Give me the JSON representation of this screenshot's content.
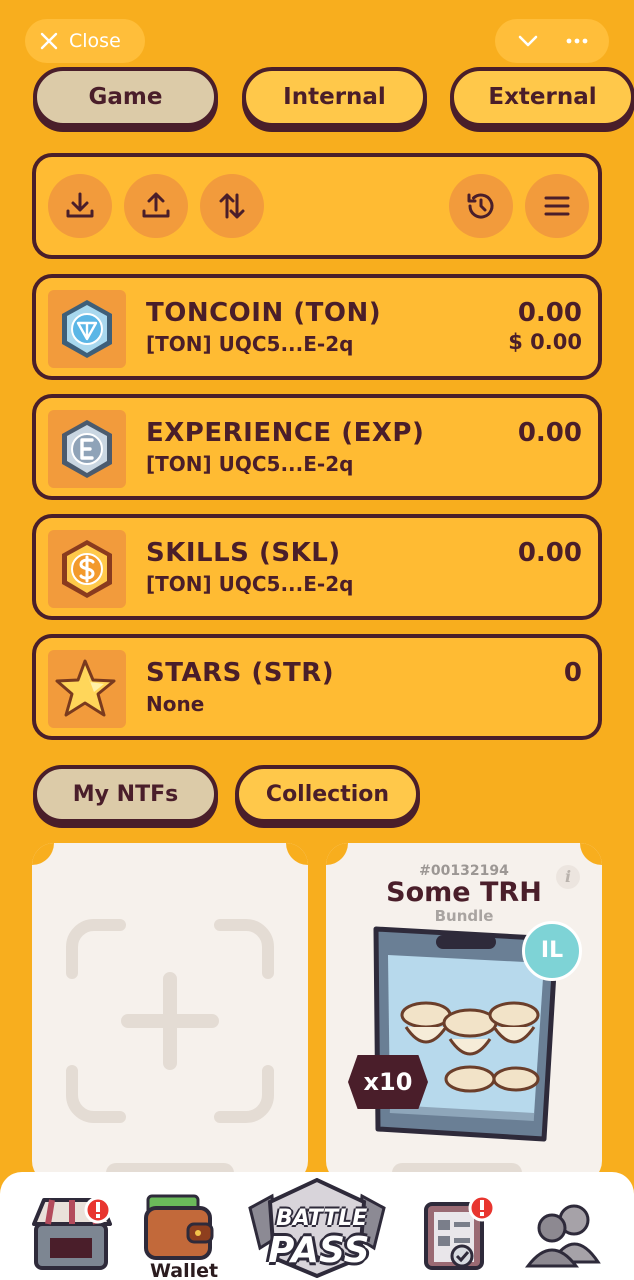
{
  "topbar": {
    "close_label": "Close",
    "close_icon": "close-icon",
    "chevron_icon": "chevron-down-icon",
    "more_icon": "more-icon"
  },
  "tabs": [
    {
      "label": "Game",
      "active": true
    },
    {
      "label": "Internal",
      "active": false
    },
    {
      "label": "External",
      "active": false
    }
  ],
  "toolbar": {
    "buttons": [
      "download-icon",
      "upload-icon",
      "swap-icon",
      "history-icon",
      "menu-icon"
    ]
  },
  "tokens": [
    {
      "name": "TONCOIN (TON)",
      "address": "[TON] UQC5...E-2q",
      "amount": "0.00",
      "usd": "$ 0.00",
      "icon": "toncoin-icon"
    },
    {
      "name": "EXPERIENCE (EXP)",
      "address": "[TON] UQC5...E-2q",
      "amount": "0.00",
      "icon": "experience-icon"
    },
    {
      "name": "SKILLS (SKL)",
      "address": "[TON] UQC5...E-2q",
      "amount": "0.00",
      "icon": "skills-icon"
    },
    {
      "name": "STARS (STR)",
      "address": "None",
      "amount": "0",
      "icon": "star-icon"
    }
  ],
  "nft_tabs": [
    {
      "label": "My NTFs",
      "active": true
    },
    {
      "label": "Collection",
      "active": false
    }
  ],
  "nft_items": [
    {
      "id": "#00132194",
      "title": "Some TRH",
      "type": "Bundle",
      "badge": "IL",
      "quantity": "x10"
    }
  ],
  "bottom_nav": {
    "items": [
      {
        "icon": "shop-icon",
        "label": ""
      },
      {
        "icon": "wallet-icon",
        "label": "Wallet"
      },
      {
        "icon": "battle-pass-icon",
        "label": ""
      },
      {
        "icon": "tasks-icon",
        "label": ""
      },
      {
        "icon": "friends-icon",
        "label": ""
      }
    ],
    "battle_pass_text_top": "BATTLE",
    "battle_pass_text_bottom": "PASS"
  },
  "colors": {
    "background": "#F8AE1E",
    "panel": "#FFBB33",
    "outline": "#4A1E2A",
    "active_tab": "#DCCBA8",
    "button": "#F29B3C"
  }
}
